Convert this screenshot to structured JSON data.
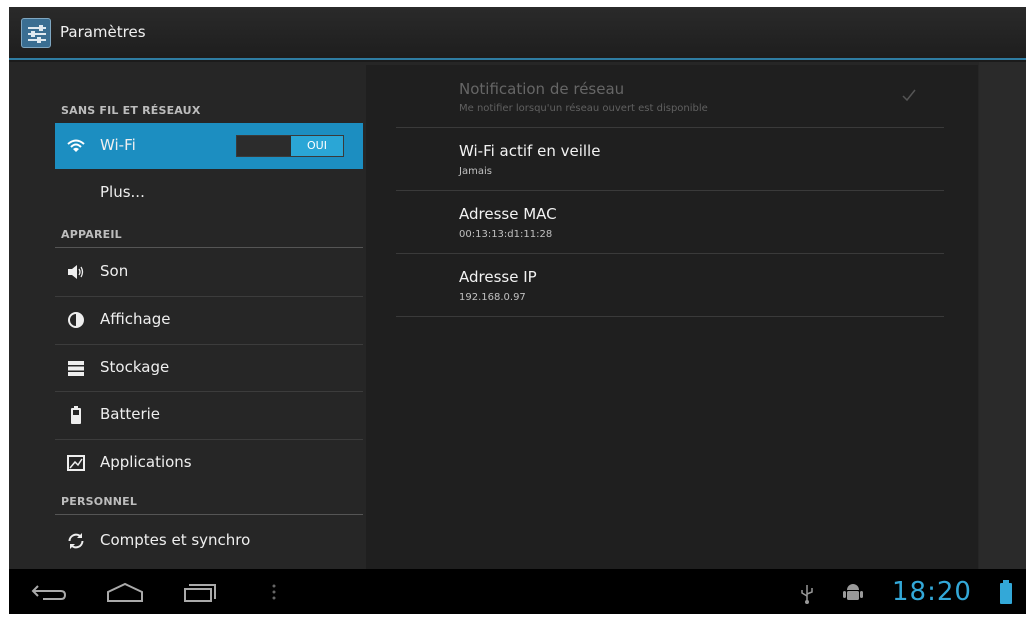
{
  "action_bar": {
    "title": "Paramètres"
  },
  "sidebar": {
    "categories": {
      "wireless": "SANS FIL ET RÉSEAUX",
      "device": "APPAREIL",
      "personal": "PERSONNEL"
    },
    "items": [
      {
        "label": "Wi-Fi",
        "icon": "wifi-icon"
      },
      {
        "label": "Plus..."
      },
      {
        "label": "Son",
        "icon": "volume-icon"
      },
      {
        "label": "Affichage",
        "icon": "display-icon"
      },
      {
        "label": "Stockage",
        "icon": "storage-icon"
      },
      {
        "label": "Batterie",
        "icon": "battery-icon"
      },
      {
        "label": "Applications",
        "icon": "applications-icon"
      },
      {
        "label": "Comptes et synchro",
        "icon": "sync-icon"
      }
    ],
    "wifi_toggle": "OUI"
  },
  "wifi_settings": [
    {
      "title": "Notification de réseau",
      "summary": "Me notifier lorsqu'un réseau ouvert est disponible",
      "disabled": true
    },
    {
      "title": "Wi-Fi actif en veille",
      "summary": "Jamais"
    },
    {
      "title": "Adresse MAC",
      "summary": "00:13:13:d1:11:28"
    },
    {
      "title": "Adresse IP",
      "summary": "192.168.0.97"
    }
  ],
  "status_bar": {
    "time": "18:20"
  },
  "colors": {
    "accent": "#1c8ec1",
    "clock": "#33a8d8"
  }
}
